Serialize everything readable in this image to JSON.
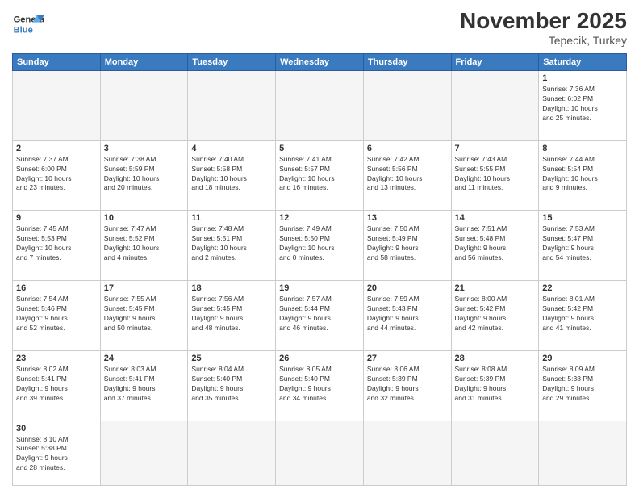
{
  "header": {
    "logo_general": "General",
    "logo_blue": "Blue",
    "title": "November 2025",
    "location": "Tepecik, Turkey"
  },
  "weekdays": [
    "Sunday",
    "Monday",
    "Tuesday",
    "Wednesday",
    "Thursday",
    "Friday",
    "Saturday"
  ],
  "weeks": [
    [
      {
        "day": "",
        "info": ""
      },
      {
        "day": "",
        "info": ""
      },
      {
        "day": "",
        "info": ""
      },
      {
        "day": "",
        "info": ""
      },
      {
        "day": "",
        "info": ""
      },
      {
        "day": "",
        "info": ""
      },
      {
        "day": "1",
        "info": "Sunrise: 7:36 AM\nSunset: 6:02 PM\nDaylight: 10 hours\nand 25 minutes."
      }
    ],
    [
      {
        "day": "2",
        "info": "Sunrise: 7:37 AM\nSunset: 6:00 PM\nDaylight: 10 hours\nand 23 minutes."
      },
      {
        "day": "3",
        "info": "Sunrise: 7:38 AM\nSunset: 5:59 PM\nDaylight: 10 hours\nand 20 minutes."
      },
      {
        "day": "4",
        "info": "Sunrise: 7:40 AM\nSunset: 5:58 PM\nDaylight: 10 hours\nand 18 minutes."
      },
      {
        "day": "5",
        "info": "Sunrise: 7:41 AM\nSunset: 5:57 PM\nDaylight: 10 hours\nand 16 minutes."
      },
      {
        "day": "6",
        "info": "Sunrise: 7:42 AM\nSunset: 5:56 PM\nDaylight: 10 hours\nand 13 minutes."
      },
      {
        "day": "7",
        "info": "Sunrise: 7:43 AM\nSunset: 5:55 PM\nDaylight: 10 hours\nand 11 minutes."
      },
      {
        "day": "8",
        "info": "Sunrise: 7:44 AM\nSunset: 5:54 PM\nDaylight: 10 hours\nand 9 minutes."
      }
    ],
    [
      {
        "day": "9",
        "info": "Sunrise: 7:45 AM\nSunset: 5:53 PM\nDaylight: 10 hours\nand 7 minutes."
      },
      {
        "day": "10",
        "info": "Sunrise: 7:47 AM\nSunset: 5:52 PM\nDaylight: 10 hours\nand 4 minutes."
      },
      {
        "day": "11",
        "info": "Sunrise: 7:48 AM\nSunset: 5:51 PM\nDaylight: 10 hours\nand 2 minutes."
      },
      {
        "day": "12",
        "info": "Sunrise: 7:49 AM\nSunset: 5:50 PM\nDaylight: 10 hours\nand 0 minutes."
      },
      {
        "day": "13",
        "info": "Sunrise: 7:50 AM\nSunset: 5:49 PM\nDaylight: 9 hours\nand 58 minutes."
      },
      {
        "day": "14",
        "info": "Sunrise: 7:51 AM\nSunset: 5:48 PM\nDaylight: 9 hours\nand 56 minutes."
      },
      {
        "day": "15",
        "info": "Sunrise: 7:53 AM\nSunset: 5:47 PM\nDaylight: 9 hours\nand 54 minutes."
      }
    ],
    [
      {
        "day": "16",
        "info": "Sunrise: 7:54 AM\nSunset: 5:46 PM\nDaylight: 9 hours\nand 52 minutes."
      },
      {
        "day": "17",
        "info": "Sunrise: 7:55 AM\nSunset: 5:45 PM\nDaylight: 9 hours\nand 50 minutes."
      },
      {
        "day": "18",
        "info": "Sunrise: 7:56 AM\nSunset: 5:45 PM\nDaylight: 9 hours\nand 48 minutes."
      },
      {
        "day": "19",
        "info": "Sunrise: 7:57 AM\nSunset: 5:44 PM\nDaylight: 9 hours\nand 46 minutes."
      },
      {
        "day": "20",
        "info": "Sunrise: 7:59 AM\nSunset: 5:43 PM\nDaylight: 9 hours\nand 44 minutes."
      },
      {
        "day": "21",
        "info": "Sunrise: 8:00 AM\nSunset: 5:42 PM\nDaylight: 9 hours\nand 42 minutes."
      },
      {
        "day": "22",
        "info": "Sunrise: 8:01 AM\nSunset: 5:42 PM\nDaylight: 9 hours\nand 41 minutes."
      }
    ],
    [
      {
        "day": "23",
        "info": "Sunrise: 8:02 AM\nSunset: 5:41 PM\nDaylight: 9 hours\nand 39 minutes."
      },
      {
        "day": "24",
        "info": "Sunrise: 8:03 AM\nSunset: 5:41 PM\nDaylight: 9 hours\nand 37 minutes."
      },
      {
        "day": "25",
        "info": "Sunrise: 8:04 AM\nSunset: 5:40 PM\nDaylight: 9 hours\nand 35 minutes."
      },
      {
        "day": "26",
        "info": "Sunrise: 8:05 AM\nSunset: 5:40 PM\nDaylight: 9 hours\nand 34 minutes."
      },
      {
        "day": "27",
        "info": "Sunrise: 8:06 AM\nSunset: 5:39 PM\nDaylight: 9 hours\nand 32 minutes."
      },
      {
        "day": "28",
        "info": "Sunrise: 8:08 AM\nSunset: 5:39 PM\nDaylight: 9 hours\nand 31 minutes."
      },
      {
        "day": "29",
        "info": "Sunrise: 8:09 AM\nSunset: 5:38 PM\nDaylight: 9 hours\nand 29 minutes."
      }
    ],
    [
      {
        "day": "30",
        "info": "Sunrise: 8:10 AM\nSunset: 5:38 PM\nDaylight: 9 hours\nand 28 minutes."
      },
      {
        "day": "",
        "info": ""
      },
      {
        "day": "",
        "info": ""
      },
      {
        "day": "",
        "info": ""
      },
      {
        "day": "",
        "info": ""
      },
      {
        "day": "",
        "info": ""
      },
      {
        "day": "",
        "info": ""
      }
    ]
  ]
}
